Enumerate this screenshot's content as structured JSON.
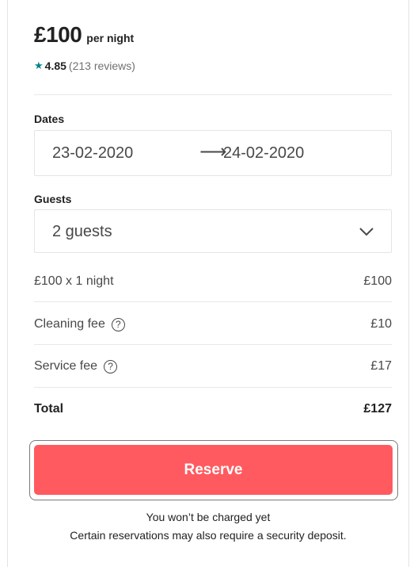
{
  "price": {
    "amount": "£100",
    "unit": "per night"
  },
  "rating": {
    "icon": "star-icon",
    "value": "4.85",
    "reviews": "(213 reviews)",
    "color": "#008489"
  },
  "dates": {
    "label": "Dates",
    "check_in": "23-02-2020",
    "check_out": "24-02-2020"
  },
  "guests": {
    "label": "Guests",
    "value": "2 guests"
  },
  "breakdown": [
    {
      "label": "£100 x 1 night",
      "amount": "£100"
    },
    {
      "label": "Cleaning fee",
      "amount": "£10"
    },
    {
      "label": "Service fee",
      "amount": "£17"
    }
  ],
  "total": {
    "label": "Total",
    "amount": "£127"
  },
  "reserve": {
    "label": "Reserve",
    "color": "#ff5a5f"
  },
  "notes": {
    "charge": "You won’t be charged yet",
    "deposit": "Certain reservations may also require a security deposit."
  }
}
